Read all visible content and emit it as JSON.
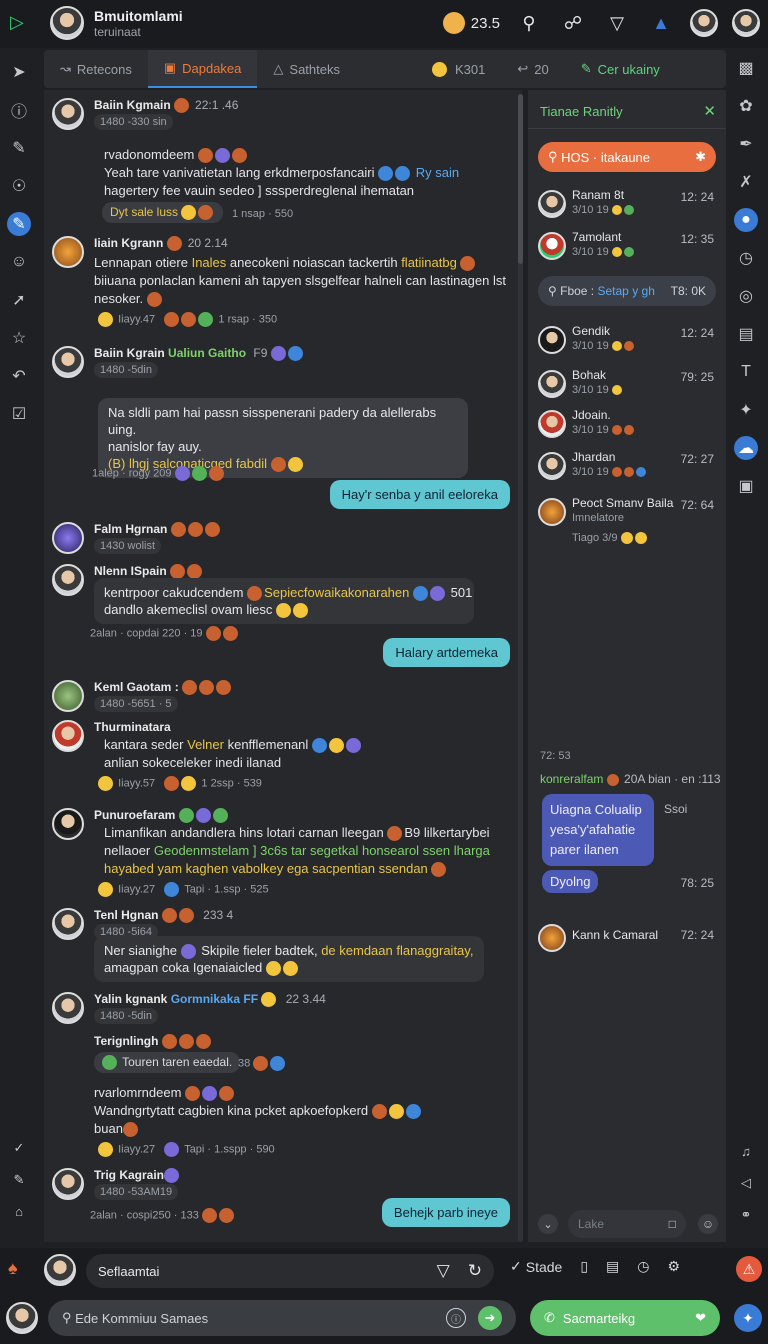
{
  "header": {
    "title": "Bmuitomlami",
    "subtitle": "teruinaat",
    "count": "23.5"
  },
  "tabs": [
    {
      "label": "Retecons",
      "icon": "chart-icon"
    },
    {
      "label": "Dapdakea",
      "icon": "bag-icon"
    },
    {
      "label": "Sathteks",
      "icon": "triangle-icon"
    },
    {
      "label": "K301",
      "icon": "emoji-icon"
    },
    {
      "label": "20",
      "icon": "reply-icon"
    },
    {
      "label": "Cer ukainy",
      "icon": "pen-icon"
    }
  ],
  "messages": [
    {
      "name": "Baiin Kgmain",
      "ts": "22:1 .46",
      "sub": "1480 -330 sin",
      "lead": "rvadonomdeem",
      "text1": "Yeah tare vanivatietan lang erkdmerposfancairi",
      "text1b": "Ry sain",
      "text2": "hagertery fee vauin sedeo ] sssperdreglenal ihematan",
      "chip": "Dyt sale luss",
      "meta": "1 nsap · 550"
    },
    {
      "name": "Iiain Kgrann",
      "ts": "20 2.14",
      "text1a": "Lennapan otiere ",
      "text1hl": "Inales",
      "text1c": " anecokeni noiascan tackertih ",
      "text1hl2": "flatiinatbg",
      "text2": "biiuana ponlaclan kameni ah tapyen slsgelfear halneli can lastinagen lst",
      "text3": "nesoker.",
      "meta1": "Iiayy.47",
      "meta2": "1 rsap · 350"
    },
    {
      "name": "Baiin Kgrain",
      "namehl": "Ualiun Gaitho",
      "ts": "F9",
      "sub": "1480 -5din",
      "bubble1": "Na sldli pam hai passn sisspenerani  padery da alellerabs uing.",
      "bubble2": "nanislor fay auy.",
      "bubble3": "(B) lhgj salconaticged fabdil",
      "meta": "1alep · rogy 209"
    },
    {
      "teal": "Hay'r senba y anil eeloreka"
    },
    {
      "name": "Falm Hgrnan",
      "sub": "1430 wolist"
    },
    {
      "name": "Nlenn ISpain",
      "text1": "kentrpoor cakudcendem",
      "text1hl": "Sepiecfowaikakonarahen",
      "text1b": "501",
      "text2": "dandlo akemeclisl ovam liesc",
      "meta": "2alan · copdai 220 · 19"
    },
    {
      "teal": "Halary artdemeka"
    },
    {
      "name": "Keml Gaotam :",
      "sub": "1480 -5651 · 5"
    },
    {
      "name": "Thurminatara",
      "text1": "kantara seder ",
      "text1hl": "Velner",
      "text1c": " kenfflemenanl",
      "text2": "anlian sokeceleker inedi ilanad",
      "meta1": "Iiayy.57",
      "meta2": "1 2ssp · 539"
    },
    {
      "name": "Punuroefaram",
      "text1": "Limanfikan andandlera hins lotari carnan lleegan",
      "text1b": "B9 lilkertarybei",
      "text2a": "nellaoer ",
      "text2hl": "Geodenmstelam ] 3c6s tar segetkal honsearol ssen lharga",
      "text3": "hayabed yam kaghen vabolkey ega sacpentian ssendan",
      "meta1": "Iiayy.27",
      "meta2": "Tapi · 1.ssp · 525"
    },
    {
      "name": "Tenl Hgnan",
      "ts": "233 4",
      "sub": "1480 -5i64",
      "text1a": "Ner sianighe ",
      "text1b": "Skipile fieler badtek, ",
      "text1hl": "de kemdaan flanaggraitay,",
      "text2": "amagpan coka Igenaiaicled"
    },
    {
      "name": "Yalin kgnank",
      "namehl": "Gormnikaka FF",
      "ts": "22 3.44",
      "sub": "1480 -5din"
    },
    {
      "name": "Terignlingh",
      "chip": "Touren taren eaedal.",
      "chipn": "38"
    },
    {
      "lead": "rvarlomrndeem",
      "text1": "Wandngrtytatt cagbien kina pcket apkoefopkerd",
      "text2": "buan",
      "meta1": "Iiayy.27",
      "meta2": "Tapi · 1.sspp · 590"
    },
    {
      "name": "Trig Kagrain",
      "sub": "1480 -53AM19"
    },
    {
      "meta": "2alan · cospi250 · 133"
    },
    {
      "teal": "Behejk parb ineye"
    }
  ],
  "panel": {
    "title": "Tianae Ranitly",
    "pill": "HOS · itakaune",
    "search_label": "Fboe : ",
    "search_hl": "Setap y gh",
    "search_ts": "T8: 0K",
    "items": [
      {
        "name": "Ranam 8t",
        "sub": "3/10 19",
        "ts": "12: 24"
      },
      {
        "name": "7amolant",
        "sub": "3/10 19",
        "ts": "12: 35"
      },
      {
        "name": "Gendik",
        "sub": "3/10 19",
        "ts": "12: 24"
      },
      {
        "name": "Bohak",
        "sub": "3/10 19",
        "ts": "79: 25"
      },
      {
        "name": "Jdoain.",
        "sub": "3/10 19",
        "ts": ""
      },
      {
        "name": "Jhardan",
        "sub": "3/10 19",
        "ts": "72: 27"
      },
      {
        "name": "Peoct Smanv Baila",
        "sub": "Imnelatore",
        "ts": "72: 64"
      }
    ],
    "extra": "Tiago 3/9",
    "date": "72: 53",
    "detail": "konreralfam",
    "detail2": "20A bian · en :113",
    "bubble_lines": [
      "Uiagna Colualip",
      "yesa'y'afahatie",
      "parer ilanen"
    ],
    "soi": "Ssoi",
    "bubble2": "Dyolng",
    "bubble2_ts": "78: 25",
    "last_name": "Kann k Camaral",
    "last_ts": "72: 24",
    "input_placeholder": "Lake"
  },
  "bottom": {
    "input1": "Seflaamtai",
    "stade": "Stade",
    "input2_placeholder": "Ede Kommiuu Samaes",
    "call": "Sacmarteikg"
  }
}
